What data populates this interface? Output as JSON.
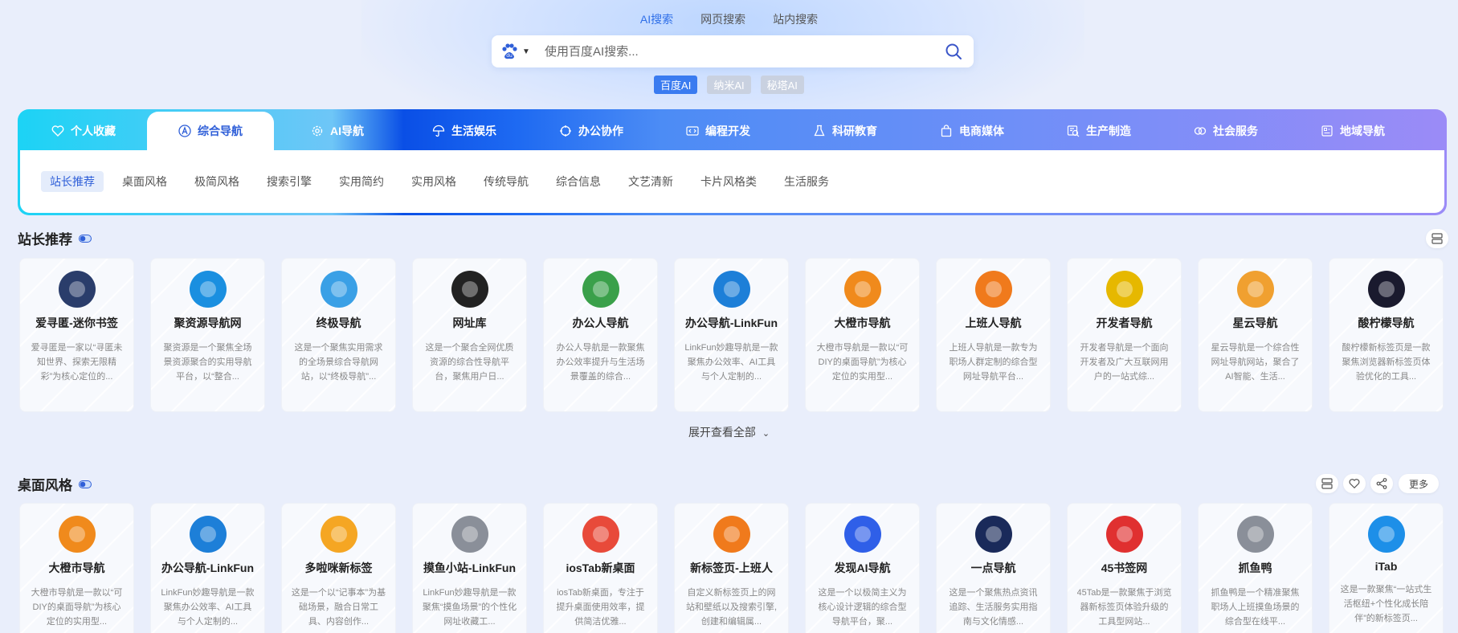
{
  "search": {
    "tabs": [
      "AI搜索",
      "网页搜索",
      "站内搜索"
    ],
    "placeholder": "使用百度AI搜索...",
    "ai_chips": [
      "百度AI",
      "纳米AI",
      "秘塔AI"
    ]
  },
  "categories": [
    {
      "label": "个人收藏",
      "icon": "heart-icon"
    },
    {
      "label": "综合导航",
      "icon": "a-circle-icon"
    },
    {
      "label": "AI导航",
      "icon": "gear-icon"
    },
    {
      "label": "生活娱乐",
      "icon": "umbrella-icon"
    },
    {
      "label": "办公协作",
      "icon": "crosshair-icon"
    },
    {
      "label": "编程开发",
      "icon": "code-icon"
    },
    {
      "label": "科研教育",
      "icon": "flask-icon"
    },
    {
      "label": "电商媒体",
      "icon": "bag-icon"
    },
    {
      "label": "生产制造",
      "icon": "factory-icon"
    },
    {
      "label": "社会服务",
      "icon": "people-icon"
    },
    {
      "label": "地域导航",
      "icon": "map-icon"
    }
  ],
  "subcategories": [
    "站长推荐",
    "桌面风格",
    "极简风格",
    "搜索引擎",
    "实用简约",
    "实用风格",
    "传统导航",
    "综合信息",
    "文艺清新",
    "卡片风格类",
    "生活服务"
  ],
  "section1": {
    "title": "站长推荐",
    "expand_label": "展开查看全部",
    "cards": [
      {
        "name": "爱寻匿-迷你书签",
        "desc": "爱寻匿是一家以“寻匿未知世界、探索无限精彩”为核心定位的...",
        "color": "#2a3d6b"
      },
      {
        "name": "聚资源导航网",
        "desc": "聚资源是一个聚焦全场景资源聚合的实用导航平台，以“整合...",
        "color": "#1a8fe0"
      },
      {
        "name": "终极导航",
        "desc": "这是一个聚焦实用需求的全场景综合导航网站，以“终极导航”...",
        "color": "#3aa0e6"
      },
      {
        "name": "网址库",
        "desc": "这是一个聚合全网优质资源的综合性导航平台，聚焦用户日...",
        "color": "#222222"
      },
      {
        "name": "办公人导航",
        "desc": "办公人导航是一款聚焦办公效率提升与生活场景覆盖的综合...",
        "color": "#3aa04a"
      },
      {
        "name": "办公导航-LinkFun",
        "desc": "LinkFun妙趣导航是一款聚焦办公效率、AI工具与个人定制的...",
        "color": "#1d7fd8"
      },
      {
        "name": "大橙市导航",
        "desc": "大橙市导航是一款以“可DIY的桌面导航”为核心定位的实用型...",
        "color": "#f08a1c"
      },
      {
        "name": "上班人导航",
        "desc": "上班人导航是一款专为职场人群定制的综合型网址导航平台...",
        "color": "#f07a1c"
      },
      {
        "name": "开发者导航",
        "desc": "开发者导航是一个面向开发者及广大互联网用户的一站式综...",
        "color": "#e6b800"
      },
      {
        "name": "星云导航",
        "desc": "星云导航是一个综合性网址导航网站，聚合了AI智能、生活...",
        "color": "#f0a030"
      },
      {
        "name": "酸柠檬导航",
        "desc": "酸柠檬新标签页是一款聚焦浏览器新标签页体验优化的工具...",
        "color": "#1a1a2e"
      }
    ]
  },
  "section2": {
    "title": "桌面风格",
    "more_label": "更多",
    "cards": [
      {
        "name": "大橙市导航",
        "desc": "大橙市导航是一款以“可DIY的桌面导航”为核心定位的实用型...",
        "color": "#f08a1c"
      },
      {
        "name": "办公导航-LinkFun",
        "desc": "LinkFun妙趣导航是一款聚焦办公效率、AI工具与个人定制的...",
        "color": "#1d7fd8"
      },
      {
        "name": "多啦咪新标签",
        "desc": "这是一个以“记事本”为基础场景，融合日常工具、内容创作...",
        "color": "#f5a623"
      },
      {
        "name": "摸鱼小站-LinkFun",
        "desc": "LinkFun妙趣导航是一款聚焦“摸鱼场景”的个性化网址收藏工...",
        "color": "#8a8f99"
      },
      {
        "name": "iosTab新桌面",
        "desc": "iosTab新桌面，专注于提升桌面使用效率，提供简洁优雅...",
        "color": "#e84a3a"
      },
      {
        "name": "新标签页-上班人",
        "desc": "自定义新标签页上的网站和壁纸以及搜索引擎,创建和编辑属...",
        "color": "#f07a1c"
      },
      {
        "name": "发现AI导航",
        "desc": "这是一个以极简主义为核心设计逻辑的综合型导航平台，聚...",
        "color": "#2f5fe8"
      },
      {
        "name": "一点导航",
        "desc": "这是一个聚焦热点资讯追踪、生活服务实用指南与文化情感...",
        "color": "#1a2a5a"
      },
      {
        "name": "45书签网",
        "desc": "45Tab是一款聚焦于浏览器新标签页体验升级的工具型网站...",
        "color": "#e03030"
      },
      {
        "name": "抓鱼鸭",
        "desc": "抓鱼鸭是一个精准聚焦职场人上班摸鱼场景的综合型在线平...",
        "color": "#8a8f99"
      },
      {
        "name": "iTab",
        "desc": "这是一款聚焦“一站式生活枢纽+个性化成长陪伴”的新标签页...",
        "color": "#1d8fe8"
      }
    ]
  }
}
